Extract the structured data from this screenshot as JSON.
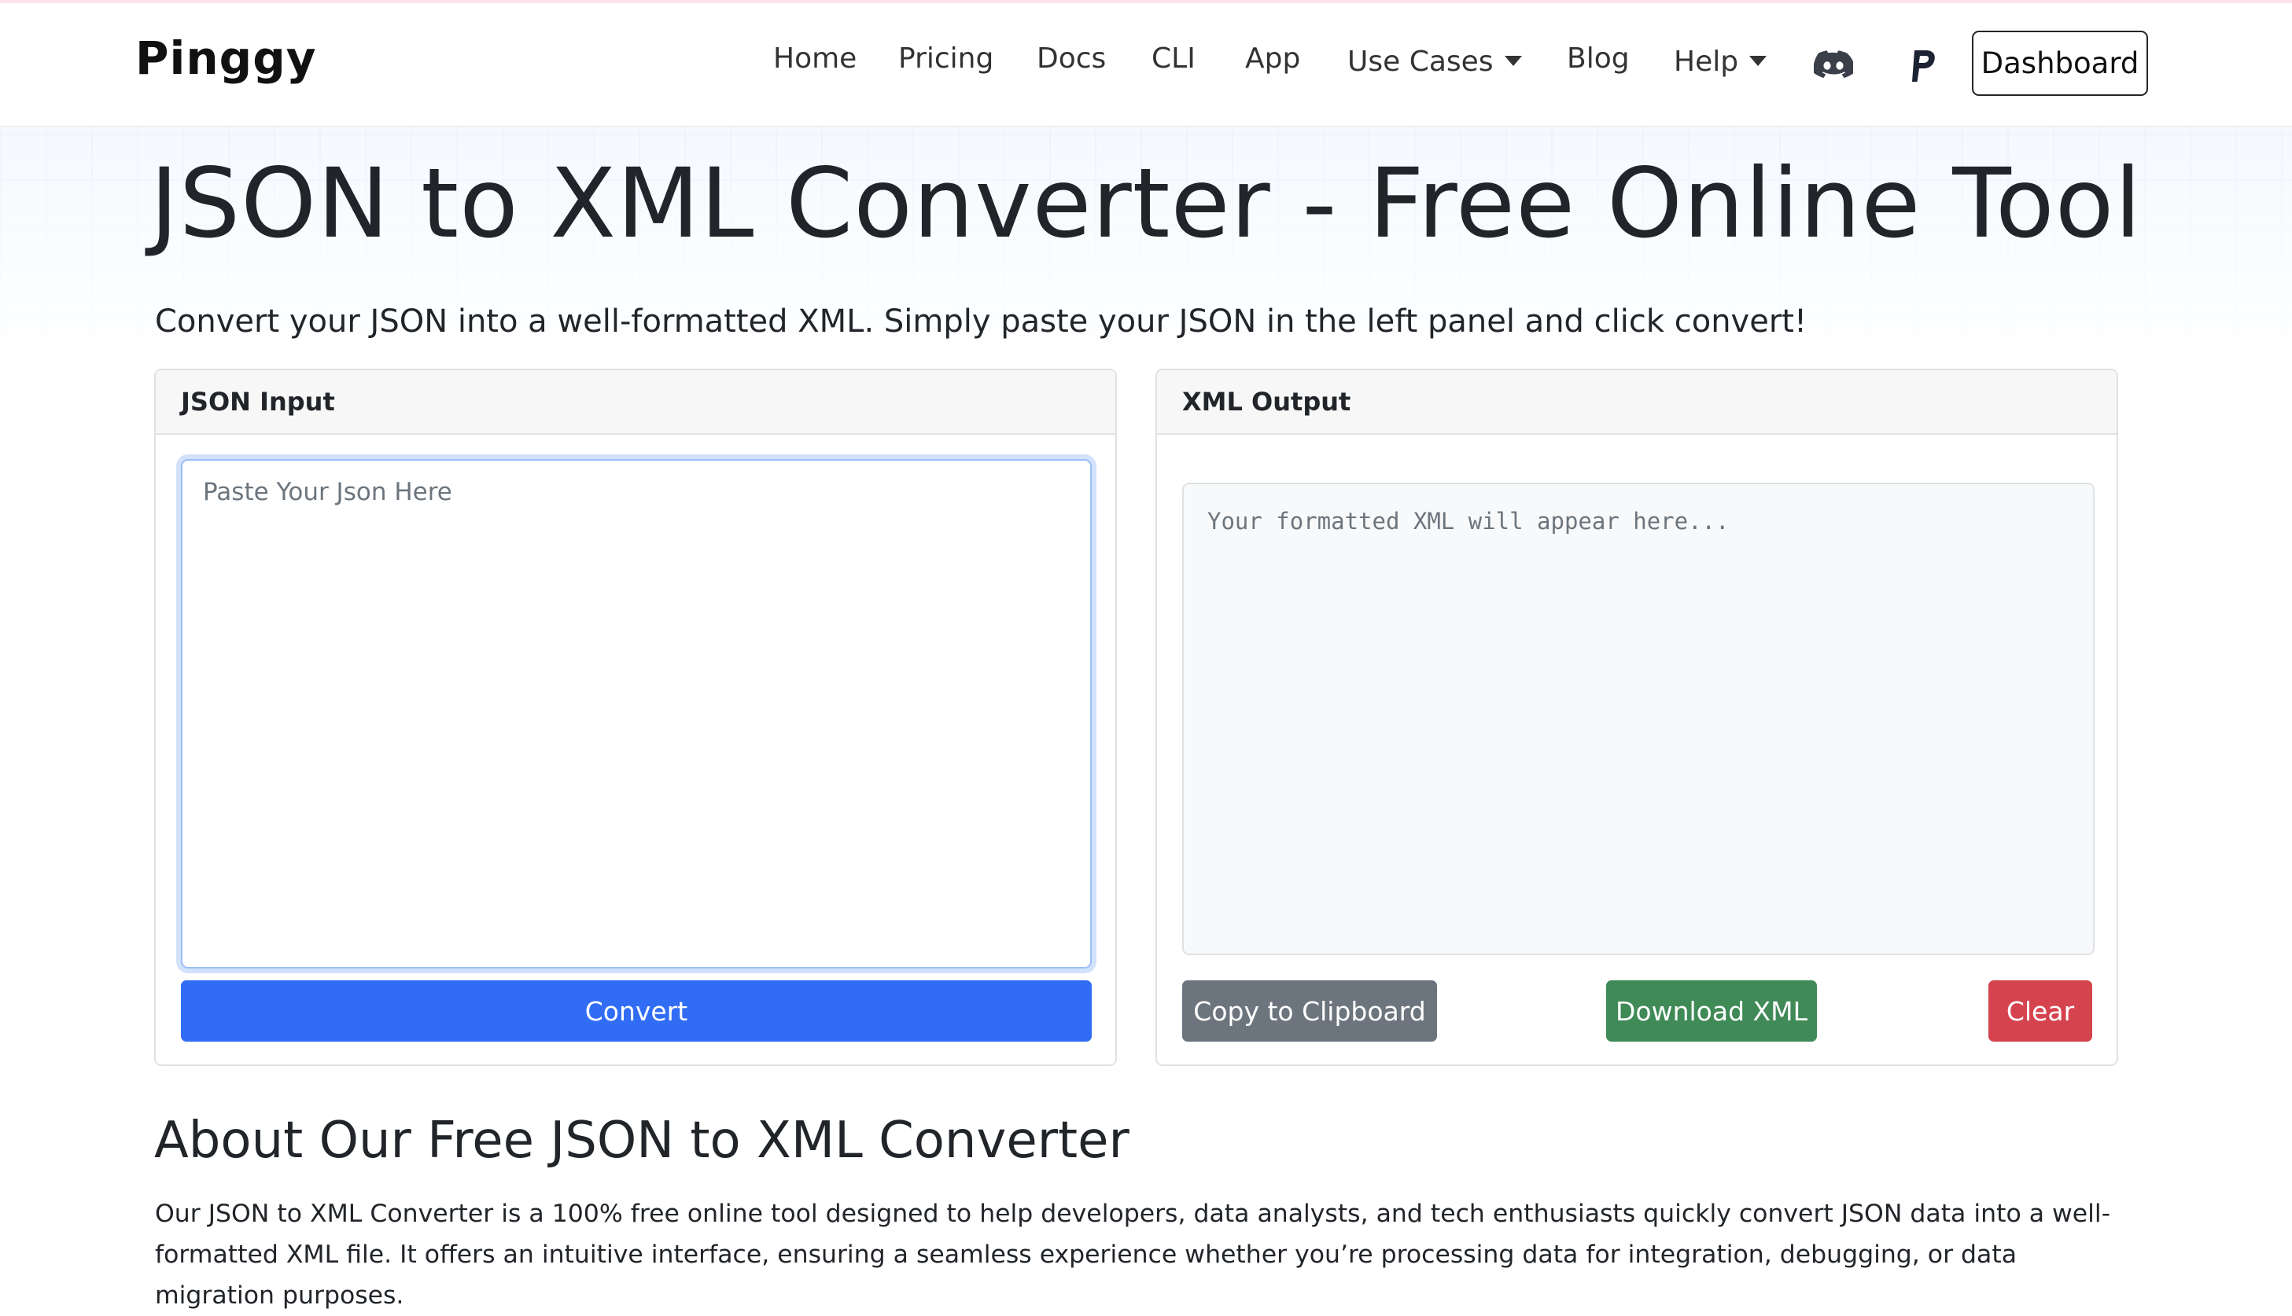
{
  "nav": {
    "brand": "Pinggy",
    "links": [
      "Home",
      "Pricing",
      "Docs",
      "CLI",
      "App"
    ],
    "use_cases": "Use Cases",
    "blog": "Blog",
    "help": "Help",
    "dashboard": "Dashboard",
    "icons": [
      "discord-icon",
      "paypal-icon"
    ]
  },
  "hero": {
    "title": "JSON to XML Converter - Free Online Tool",
    "lead": "Convert your JSON into a well-formatted XML. Simply paste your JSON in the left panel and click convert!"
  },
  "input_panel": {
    "header": "JSON Input",
    "placeholder": "Paste Your Json Here",
    "value": "",
    "convert_label": "Convert"
  },
  "output_panel": {
    "header": "XML Output",
    "placeholder": "Your formatted XML will appear here...",
    "copy_label": "Copy to Clipboard",
    "download_label": "Download XML",
    "clear_label": "Clear"
  },
  "about": {
    "title": "About Our Free JSON to XML Converter",
    "text": "Our JSON to XML Converter is a 100% free online tool designed to help developers, data analysts, and tech enthusiasts quickly convert JSON data into a well-formatted XML file. It offers an intuitive interface, ensuring a seamless experience whether you’re processing data for integration, debugging, or data migration purposes."
  },
  "colors": {
    "primary": "#316df4",
    "secondary": "#6c757d",
    "success": "#3f8a57",
    "danger": "#d5434f"
  }
}
